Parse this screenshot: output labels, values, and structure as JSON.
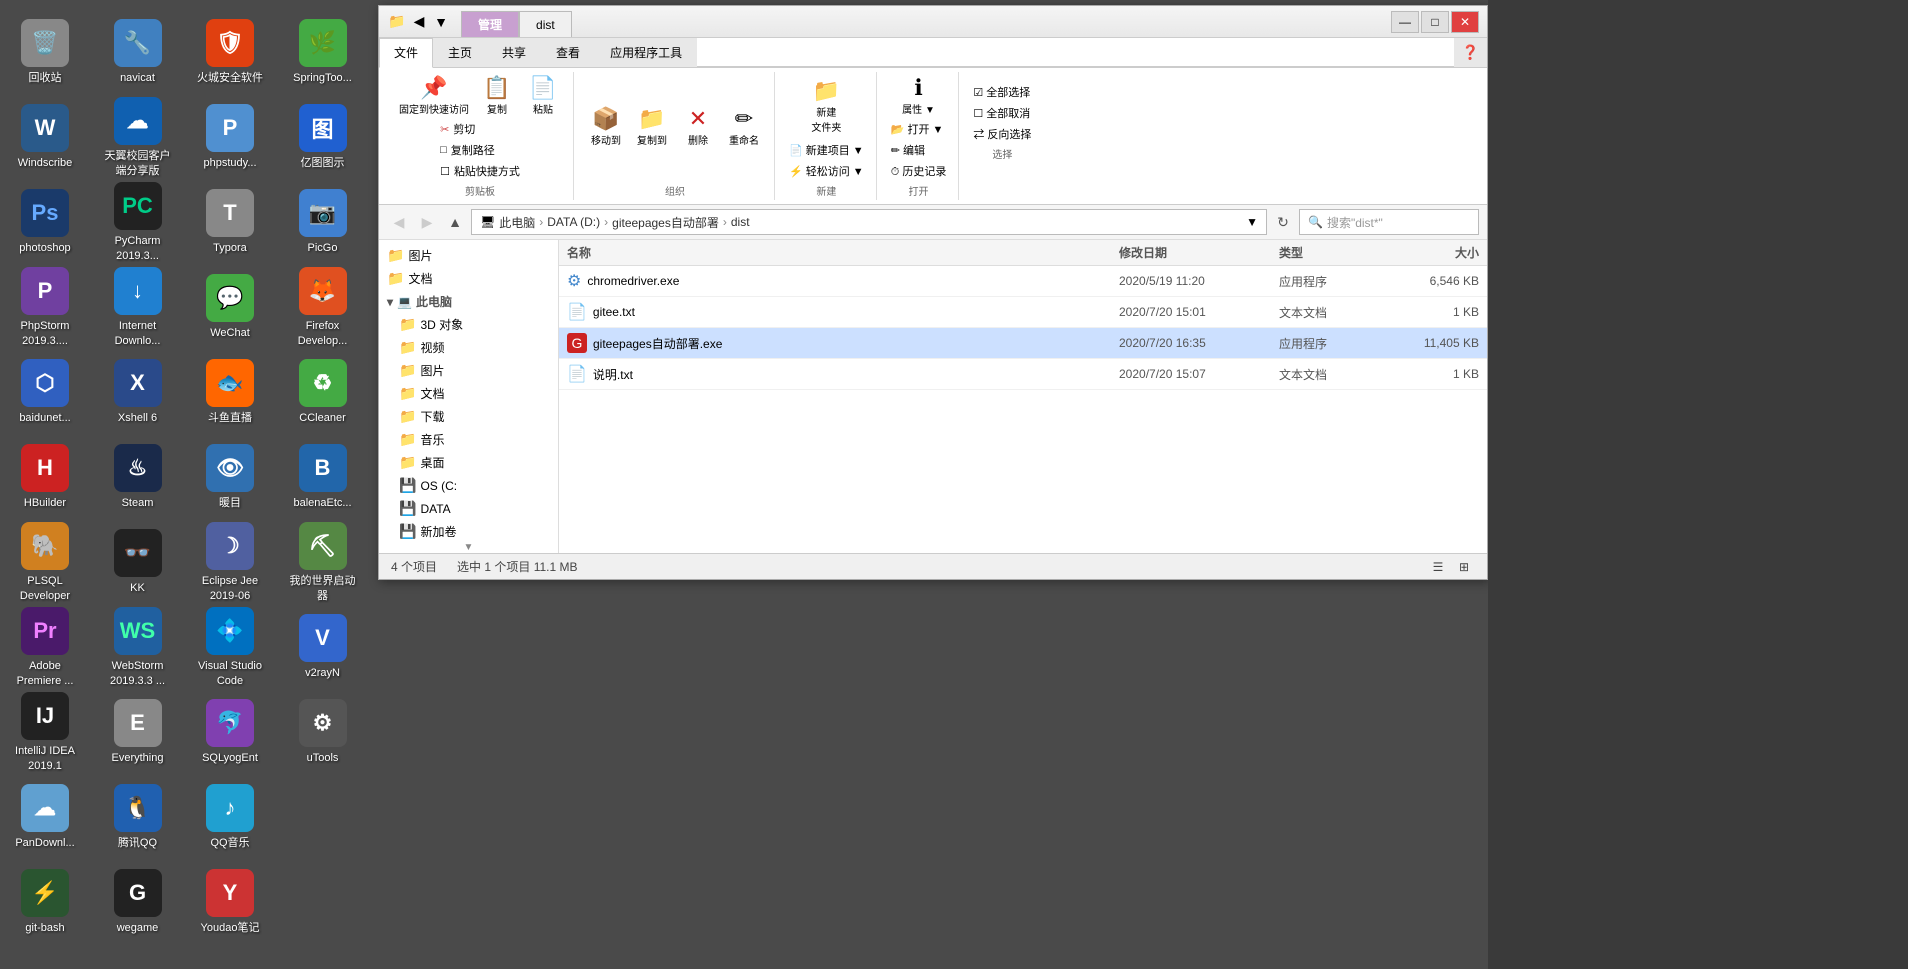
{
  "desktop": {
    "icons": [
      {
        "id": "recycle",
        "label": "回收站",
        "bg": "#888",
        "color": "#fff",
        "symbol": "🗑️"
      },
      {
        "id": "windscribe",
        "label": "Windscribe",
        "bg": "#2a5a8a",
        "color": "#fff",
        "symbol": "W"
      },
      {
        "id": "photoshop",
        "label": "photoshop",
        "bg": "#1a3a6a",
        "color": "#6af",
        "symbol": "Ps"
      },
      {
        "id": "phpstorm",
        "label": "PhpStorm 2019.3....",
        "bg": "#7040a0",
        "color": "#fff",
        "symbol": "P"
      },
      {
        "id": "baidunet",
        "label": "baidunet...",
        "bg": "#3060c0",
        "color": "#fff",
        "symbol": "⬡"
      },
      {
        "id": "hbuilder",
        "label": "HBuilder",
        "bg": "#cc2222",
        "color": "#fff",
        "symbol": "H"
      },
      {
        "id": "plsql",
        "label": "PLSQL Developer",
        "bg": "#d08020",
        "color": "#fff",
        "symbol": "🐘"
      },
      {
        "id": "premiere",
        "label": "Adobe Premiere ...",
        "bg": "#4a1a6a",
        "color": "#f080ff",
        "symbol": "Pr"
      },
      {
        "id": "intellij",
        "label": "IntelliJ IDEA 2019.1",
        "bg": "#222",
        "color": "#fff",
        "symbol": "IJ"
      },
      {
        "id": "pandownl",
        "label": "PanDownl...",
        "bg": "#60a0d0",
        "color": "#fff",
        "symbol": "☁"
      },
      {
        "id": "gitbash",
        "label": "git-bash",
        "bg": "#2a5530",
        "color": "#fff",
        "symbol": "⚡"
      },
      {
        "id": "navicat",
        "label": "navicat",
        "bg": "#4080c0",
        "color": "#fff",
        "symbol": "🔧"
      },
      {
        "id": "tianyiyunke",
        "label": "天翼校园客户端分享版",
        "bg": "#1060b0",
        "color": "#fff",
        "symbol": "☁"
      },
      {
        "id": "pycharm",
        "label": "PyCharm 2019.3...",
        "bg": "#222",
        "color": "#00cc88",
        "symbol": "PC"
      },
      {
        "id": "internet",
        "label": "Internet Downlo...",
        "bg": "#2080d0",
        "color": "#fff",
        "symbol": "↓"
      },
      {
        "id": "xshell",
        "label": "Xshell 6",
        "bg": "#2a4a8a",
        "color": "#fff",
        "symbol": "X"
      },
      {
        "id": "steam",
        "label": "Steam",
        "bg": "#1a2a4a",
        "color": "#fff",
        "symbol": "♨"
      },
      {
        "id": "kk",
        "label": "KK",
        "bg": "#222",
        "color": "#fff",
        "symbol": "👓"
      },
      {
        "id": "webstorm",
        "label": "WebStorm 2019.3.3 ...",
        "bg": "#2060a0",
        "color": "#40ffaa",
        "symbol": "WS"
      },
      {
        "id": "everything",
        "label": "Everything",
        "bg": "#888",
        "color": "#fff",
        "symbol": "E"
      },
      {
        "id": "tencentqq",
        "label": "腾讯QQ",
        "bg": "#2060b0",
        "color": "#fff",
        "symbol": "🐧"
      },
      {
        "id": "wegame",
        "label": "wegame",
        "bg": "#222",
        "color": "#fff",
        "symbol": "G"
      },
      {
        "id": "huocheng",
        "label": "火城安全软件",
        "bg": "#e04010",
        "color": "#fff",
        "symbol": "🛡"
      },
      {
        "id": "phpstudy",
        "label": "phpstudy...",
        "bg": "#5090d0",
        "color": "#fff",
        "symbol": "P"
      },
      {
        "id": "typora",
        "label": "Typora",
        "bg": "#888",
        "color": "#fff",
        "symbol": "T"
      },
      {
        "id": "wechat",
        "label": "WeChat",
        "bg": "#44aa44",
        "color": "#fff",
        "symbol": "💬"
      },
      {
        "id": "douyu",
        "label": "斗鱼直播",
        "bg": "#ff6600",
        "color": "#fff",
        "symbol": "🐟"
      },
      {
        "id": "nuanmu",
        "label": "暖目",
        "bg": "#3070b0",
        "color": "#fff",
        "symbol": "👁"
      },
      {
        "id": "eclipse",
        "label": "Eclipse Jee 2019-06",
        "bg": "#5060a0",
        "color": "#fff",
        "symbol": "☽"
      },
      {
        "id": "vscode",
        "label": "Visual Studio Code",
        "bg": "#0070c0",
        "color": "#fff",
        "symbol": "💠"
      },
      {
        "id": "sqlyog",
        "label": "SQLyogEnt",
        "bg": "#8040b0",
        "color": "#fff",
        "symbol": "🐬"
      },
      {
        "id": "qqmusic",
        "label": "QQ音乐",
        "bg": "#20a0d0",
        "color": "#fff",
        "symbol": "♪"
      },
      {
        "id": "youdao",
        "label": "Youdao笔记",
        "bg": "#cc3333",
        "color": "#fff",
        "symbol": "Y"
      },
      {
        "id": "spring",
        "label": "SpringToo...",
        "bg": "#44aa44",
        "color": "#fff",
        "symbol": "🌿"
      },
      {
        "id": "yitu",
        "label": "亿图图示",
        "bg": "#2060d0",
        "color": "#fff",
        "symbol": "图"
      },
      {
        "id": "picgo",
        "label": "PicGo",
        "bg": "#4080d0",
        "color": "#fff",
        "symbol": "📷"
      },
      {
        "id": "firefox",
        "label": "Firefox Develop...",
        "bg": "#e05020",
        "color": "#fff",
        "symbol": "🦊"
      },
      {
        "id": "ccleaner",
        "label": "CCleaner",
        "bg": "#44aa44",
        "color": "#fff",
        "symbol": "♻"
      },
      {
        "id": "balena",
        "label": "balenaEtc...",
        "bg": "#2266aa",
        "color": "#fff",
        "symbol": "B"
      },
      {
        "id": "minecraft",
        "label": "我的世界启动器",
        "bg": "#558844",
        "color": "#fff",
        "symbol": "⛏"
      },
      {
        "id": "v2rayn",
        "label": "v2rayN",
        "bg": "#3366cc",
        "color": "#fff",
        "symbol": "V"
      },
      {
        "id": "utools",
        "label": "uTools",
        "bg": "#555",
        "color": "#fff",
        "symbol": "⚙"
      }
    ]
  },
  "explorer": {
    "title": "dist",
    "ribbon_tabs": [
      "文件",
      "主页",
      "共享",
      "查看",
      "应用程序工具"
    ],
    "active_ribbon_tab": "主页",
    "title_tabs": [
      "管理",
      "dist"
    ],
    "active_title_tab": "管理",
    "window_controls": [
      "—",
      "□",
      "✕"
    ],
    "ribbon": {
      "groups": [
        {
          "label": "剪贴板",
          "buttons": [
            {
              "label": "固定到快速访问",
              "icon": "📌"
            },
            {
              "label": "复制",
              "icon": "📋"
            },
            {
              "label": "粘贴",
              "icon": "📄"
            }
          ],
          "small_buttons": [
            "✂ 剪切",
            "□ 复制路径",
            "☐ 粘贴快捷方式"
          ]
        },
        {
          "label": "组织",
          "buttons": [
            {
              "label": "移动到",
              "icon": "→"
            },
            {
              "label": "复制到",
              "icon": "⧉"
            },
            {
              "label": "删除",
              "icon": "✕"
            },
            {
              "label": "重命名",
              "icon": "✎"
            }
          ]
        },
        {
          "label": "新建",
          "buttons": [
            {
              "label": "新建文件夹",
              "icon": "📁"
            },
            {
              "label": "新建项目▼",
              "icon": "📄"
            },
            {
              "label": "轻松访问▼",
              "icon": "⚡"
            }
          ]
        },
        {
          "label": "打开",
          "buttons": [
            {
              "label": "属性▼",
              "icon": "ℹ"
            },
            {
              "label": "打开▼",
              "icon": "📂"
            },
            {
              "label": "编辑",
              "icon": "✏"
            },
            {
              "label": "历史记录",
              "icon": "⏱"
            }
          ]
        },
        {
          "label": "选择",
          "buttons": [
            {
              "label": "全部选择",
              "icon": "☑"
            },
            {
              "label": "全部取消",
              "icon": "☐"
            },
            {
              "label": "反向选择",
              "icon": "⇄"
            }
          ]
        }
      ]
    },
    "address_bar": {
      "path": "此电脑 > DATA (D:) > giteepages自动部署 > dist",
      "path_parts": [
        "此电脑",
        "DATA (D:)",
        "giteepages自动部署",
        "dist"
      ],
      "search_placeholder": "搜索\"dist*\""
    },
    "sidebar": {
      "items": [
        {
          "label": "图片",
          "icon": "📁",
          "level": 0
        },
        {
          "label": "文档",
          "icon": "📁",
          "level": 0
        },
        {
          "label": "此电脑",
          "icon": "💻",
          "level": 0,
          "expanded": true
        },
        {
          "label": "3D 对象",
          "icon": "📁",
          "level": 1
        },
        {
          "label": "视频",
          "icon": "📁",
          "level": 1
        },
        {
          "label": "图片",
          "icon": "📁",
          "level": 1
        },
        {
          "label": "文档",
          "icon": "📁",
          "level": 1
        },
        {
          "label": "下载",
          "icon": "📁",
          "level": 1
        },
        {
          "label": "音乐",
          "icon": "📁",
          "level": 1
        },
        {
          "label": "桌面",
          "icon": "📁",
          "level": 1
        },
        {
          "label": "OS (C:)",
          "icon": "💾",
          "level": 1
        },
        {
          "label": "DATA (D:)",
          "icon": "💾",
          "level": 1
        },
        {
          "label": "新加卷",
          "icon": "💾",
          "level": 1
        }
      ]
    },
    "files": [
      {
        "name": "chromedriver.exe",
        "icon": "⚙",
        "icon_color": "#4488cc",
        "date": "2020/5/19 11:20",
        "type": "应用程序",
        "size": "6,546 KB",
        "selected": false
      },
      {
        "name": "gitee.txt",
        "icon": "📄",
        "icon_color": "#888",
        "date": "2020/7/20 15:01",
        "type": "文本文档",
        "size": "1 KB",
        "selected": false
      },
      {
        "name": "giteepages自动部署.exe",
        "icon": "G",
        "icon_color": "#cc2222",
        "date": "2020/7/20 16:35",
        "type": "应用程序",
        "size": "11,405 KB",
        "selected": true
      },
      {
        "name": "说明.txt",
        "icon": "📄",
        "icon_color": "#888",
        "date": "2020/7/20 15:07",
        "type": "文本文档",
        "size": "1 KB",
        "selected": false
      }
    ],
    "file_columns": [
      "名称",
      "修改日期",
      "类型",
      "大小"
    ],
    "status": {
      "count": "4 个项目",
      "selected": "选中 1 个项目  11.1 MB"
    }
  }
}
